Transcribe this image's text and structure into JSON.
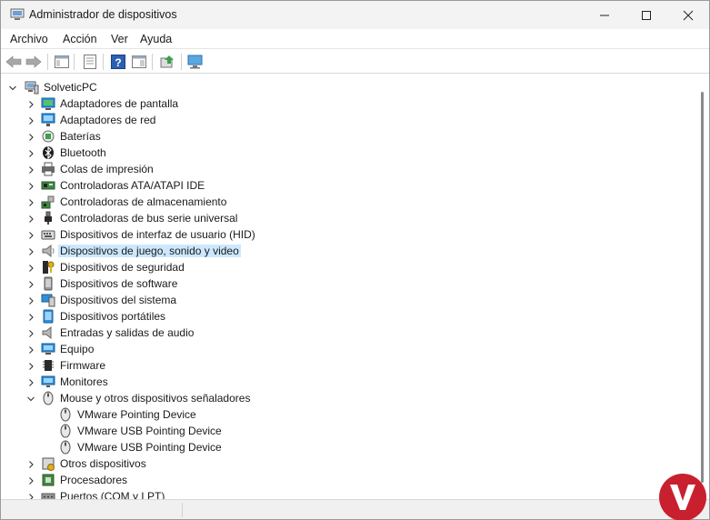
{
  "window": {
    "title": "Administrador de dispositivos",
    "icon": "device-manager-icon"
  },
  "menu": [
    {
      "label": "Archivo"
    },
    {
      "label": "Acción"
    },
    {
      "label": "Ver"
    },
    {
      "label": "Ayuda"
    }
  ],
  "toolbar": {
    "buttons": [
      "back-icon",
      "forward-icon",
      "show-hide-console-tree-icon",
      "properties-icon",
      "help-icon",
      "show-action-pane-icon",
      "update-driver-icon",
      "scan-hardware-icon"
    ]
  },
  "tree": {
    "root": {
      "label": "SolveticPC",
      "icon": "computer-root-icon",
      "expanded": true
    },
    "items": [
      {
        "label": "Adaptadores de pantalla",
        "icon": "display-adapter-icon",
        "expanded": false,
        "level": 1
      },
      {
        "label": "Adaptadores de red",
        "icon": "network-adapter-icon",
        "expanded": false,
        "level": 1
      },
      {
        "label": "Baterías",
        "icon": "battery-icon",
        "expanded": false,
        "level": 1
      },
      {
        "label": "Bluetooth",
        "icon": "bluetooth-icon",
        "expanded": false,
        "level": 1
      },
      {
        "label": "Colas de impresión",
        "icon": "printer-icon",
        "expanded": false,
        "level": 1
      },
      {
        "label": "Controladoras ATA/ATAPI IDE",
        "icon": "ide-controller-icon",
        "expanded": false,
        "level": 1
      },
      {
        "label": "Controladoras de almacenamiento",
        "icon": "storage-controller-icon",
        "expanded": false,
        "level": 1
      },
      {
        "label": "Controladoras de bus serie universal",
        "icon": "usb-icon",
        "expanded": false,
        "level": 1
      },
      {
        "label": "Dispositivos de interfaz de usuario (HID)",
        "icon": "hid-icon",
        "expanded": false,
        "level": 1
      },
      {
        "label": "Dispositivos de juego, sonido y video",
        "icon": "sound-icon",
        "expanded": false,
        "level": 1,
        "selected": true
      },
      {
        "label": "Dispositivos de seguridad",
        "icon": "security-device-icon",
        "expanded": false,
        "level": 1
      },
      {
        "label": "Dispositivos de software",
        "icon": "software-device-icon",
        "expanded": false,
        "level": 1
      },
      {
        "label": "Dispositivos del sistema",
        "icon": "system-device-icon",
        "expanded": false,
        "level": 1
      },
      {
        "label": "Dispositivos portátiles",
        "icon": "portable-device-icon",
        "expanded": false,
        "level": 1
      },
      {
        "label": "Entradas y salidas de audio",
        "icon": "audio-io-icon",
        "expanded": false,
        "level": 1
      },
      {
        "label": "Equipo",
        "icon": "computer-icon",
        "expanded": false,
        "level": 1
      },
      {
        "label": "Firmware",
        "icon": "firmware-icon",
        "expanded": false,
        "level": 1
      },
      {
        "label": "Monitores",
        "icon": "monitor-icon",
        "expanded": false,
        "level": 1
      },
      {
        "label": "Mouse y otros dispositivos señaladores",
        "icon": "mouse-icon",
        "expanded": true,
        "level": 1
      },
      {
        "label": "VMware Pointing Device",
        "icon": "mouse-icon",
        "level": 2
      },
      {
        "label": "VMware USB Pointing Device",
        "icon": "mouse-icon",
        "level": 2
      },
      {
        "label": "VMware USB Pointing Device",
        "icon": "mouse-icon",
        "level": 2
      },
      {
        "label": "Otros dispositivos",
        "icon": "unknown-device-icon",
        "expanded": false,
        "level": 1
      },
      {
        "label": "Procesadores",
        "icon": "processor-icon",
        "expanded": false,
        "level": 1
      },
      {
        "label": "Puertos (COM y LPT)",
        "icon": "port-icon",
        "expanded": false,
        "level": 1
      }
    ]
  },
  "colors": {
    "selection": "#cce8ff",
    "titlebar": "#f3f3f3",
    "accent": "#0078d4"
  }
}
